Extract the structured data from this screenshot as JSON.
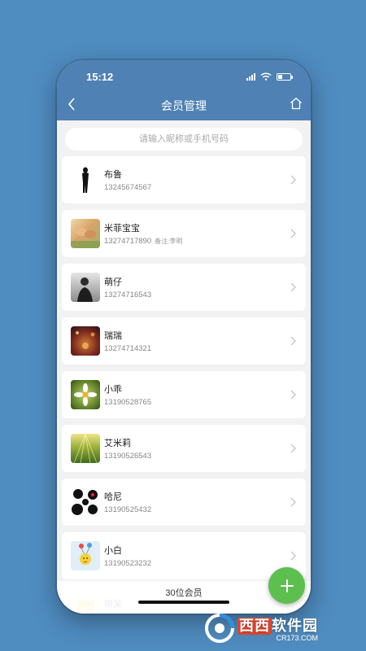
{
  "status_bar": {
    "time": "15:12"
  },
  "header": {
    "title": "会员管理"
  },
  "search": {
    "placeholder": "请输入昵称或手机号码"
  },
  "members": [
    {
      "name": "布鲁",
      "phone": "13245674567",
      "note": ""
    },
    {
      "name": "米菲宝宝",
      "phone": "13274717890",
      "note": "备注:李明"
    },
    {
      "name": "萌仔",
      "phone": "13274716543",
      "note": ""
    },
    {
      "name": "瑞瑞",
      "phone": "13274714321",
      "note": ""
    },
    {
      "name": "小乖",
      "phone": "13190528765",
      "note": ""
    },
    {
      "name": "艾米莉",
      "phone": "13190526543",
      "note": ""
    },
    {
      "name": "哈尼",
      "phone": "13190525432",
      "note": ""
    },
    {
      "name": "小白",
      "phone": "13190523232",
      "note": ""
    },
    {
      "name": "啊呆",
      "phone": "",
      "note": ""
    }
  ],
  "footer": {
    "count": "30位会员"
  },
  "watermark": {
    "brand_a": "西西",
    "brand_b": "软件园",
    "domain": "CR173.COM"
  },
  "colors": {
    "header": "#4f81b4",
    "background": "#4f8cc0",
    "fab": "#5cbf4e"
  },
  "icons": {
    "back": "chevron-left-icon",
    "home": "home-icon",
    "add": "plus-icon",
    "row": "chevron-right-icon"
  }
}
